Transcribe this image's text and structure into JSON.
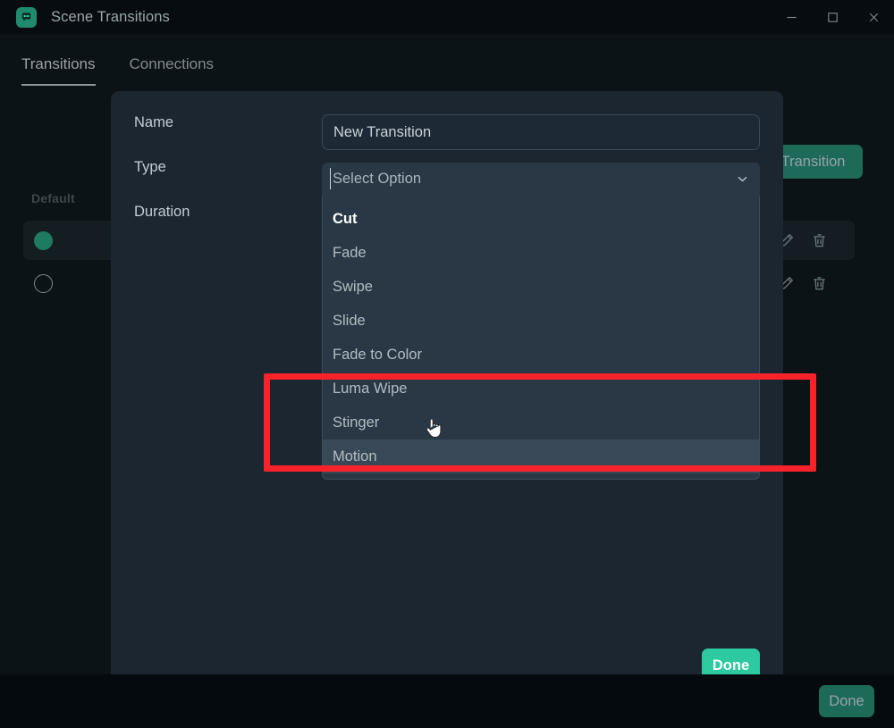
{
  "window": {
    "title": "Scene Transitions",
    "app_icon": "robot-icon",
    "controls": {
      "minimize": "minimize-icon",
      "maximize": "maximize-icon",
      "close": "close-icon"
    }
  },
  "tabs": [
    {
      "label": "Transitions",
      "active": true
    },
    {
      "label": "Connections",
      "active": false
    }
  ],
  "background": {
    "add_button_label": "Add Transition",
    "list_header": "Default",
    "rows": [
      {
        "indicator": "filled",
        "edit_icon": "pencil-icon",
        "delete_icon": "trash-icon",
        "selected": true
      },
      {
        "indicator": "hollow",
        "edit_icon": "pencil-icon",
        "delete_icon": "trash-icon",
        "selected": false
      }
    ],
    "done_label": "Done"
  },
  "modal": {
    "labels": {
      "name": "Name",
      "type": "Type",
      "duration": "Duration"
    },
    "name_value": "New Transition",
    "name_placeholder": "New Transition",
    "select": {
      "value": "Select Option",
      "chevron": "chevron-down-icon",
      "options": [
        {
          "label": "Cut",
          "state": "selected"
        },
        {
          "label": "Fade",
          "state": "normal"
        },
        {
          "label": "Swipe",
          "state": "normal"
        },
        {
          "label": "Slide",
          "state": "normal"
        },
        {
          "label": "Fade to Color",
          "state": "normal"
        },
        {
          "label": "Luma Wipe",
          "state": "normal"
        },
        {
          "label": "Stinger",
          "state": "normal"
        },
        {
          "label": "Motion",
          "state": "hover"
        }
      ]
    },
    "done_label": "Done"
  },
  "annotation": {
    "color": "#f8222a",
    "shape": "rectangle"
  },
  "colors": {
    "app_background": "#0b1316",
    "titlebar": "#060c0f",
    "modal_background": "#1b2631",
    "select_background": "#2a3845",
    "accent_green": "#2dc99f",
    "muted_green": "#1d6a58",
    "annotation_red": "#f8222a"
  }
}
